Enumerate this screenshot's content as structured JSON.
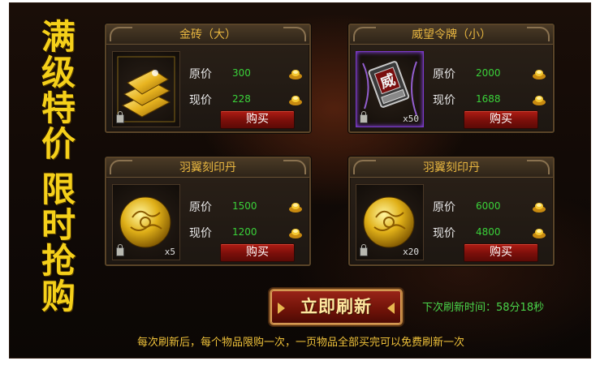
{
  "banner": {
    "line1": [
      "满",
      "级",
      "特",
      "价"
    ],
    "line2": [
      "限",
      "时",
      "抢",
      "购"
    ]
  },
  "labels": {
    "original_price": "原价",
    "current_price": "现价",
    "buy": "购买"
  },
  "items": [
    {
      "name": "金砖（大）",
      "icon": "gold-bricks-icon",
      "quantity": "",
      "original_price": "300",
      "current_price": "228"
    },
    {
      "name": "威望令牌（小）",
      "icon": "prestige-token-icon",
      "quantity": "x50",
      "original_price": "2000",
      "current_price": "1688"
    },
    {
      "name": "羽翼刻印丹",
      "icon": "gold-orb-icon",
      "quantity": "x5",
      "original_price": "1500",
      "current_price": "1200"
    },
    {
      "name": "羽翼刻印丹",
      "icon": "gold-orb-icon",
      "quantity": "x20",
      "original_price": "6000",
      "current_price": "4800"
    }
  ],
  "currency_icon": "gold-ingot-icon",
  "refresh": {
    "button_label": "立即刷新",
    "next_refresh_text": "下次刷新时间：58分18秒"
  },
  "notice": "每次刷新后，每个物品限购一次，一页物品全部买完可以免费刷新一次",
  "colors": {
    "banner_text": "#f5d01a",
    "price_value": "#3ad23a",
    "title_text": "#e8b640",
    "buy_button": "#b01c14",
    "notice_text": "#f0c23a",
    "timer_text": "#4ad54a"
  }
}
